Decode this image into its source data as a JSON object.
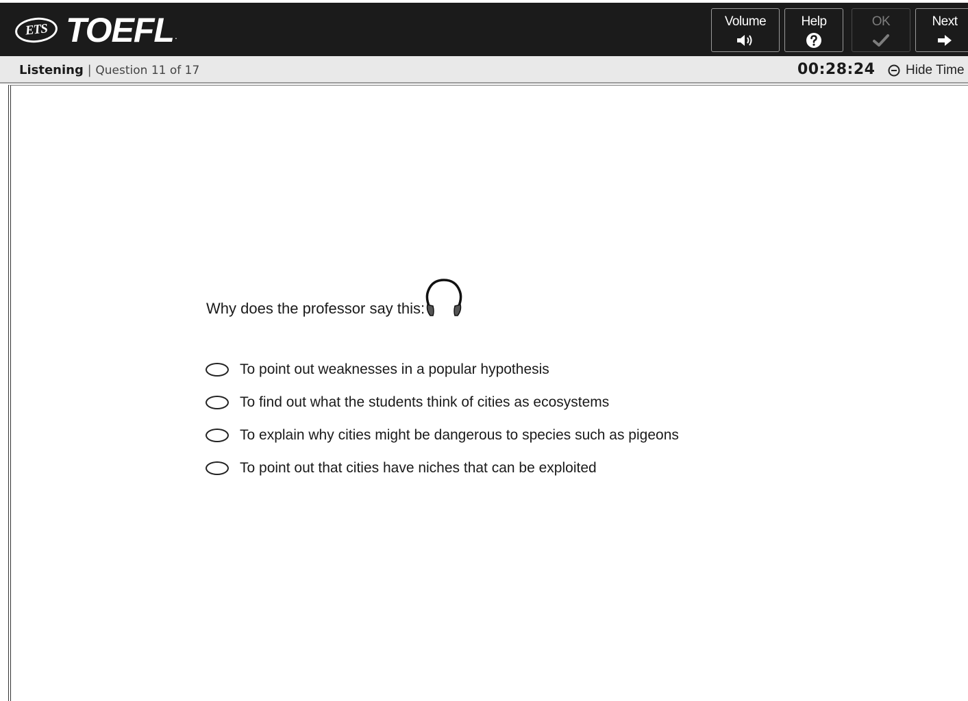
{
  "header": {
    "logo": {
      "ets": "ETS",
      "product": "TOEFL",
      "dot": "."
    },
    "buttons": {
      "volume": {
        "label": "Volume",
        "icon": "speaker-icon"
      },
      "help": {
        "label": "Help",
        "icon": "question-circle-icon"
      },
      "ok": {
        "label": "OK",
        "icon": "checkmark-icon",
        "disabled": true
      },
      "next": {
        "label": "Next",
        "icon": "arrow-right-icon"
      }
    }
  },
  "status": {
    "section": "Listening",
    "separator": "|",
    "question_progress": "Question 11 of 17",
    "timer": "00:28:24",
    "hide_time_label": "Hide Time"
  },
  "question": {
    "prompt": "Why does the professor say this:",
    "audio_icon": "headphones-icon",
    "options": [
      "To point out weaknesses in a popular hypothesis",
      "To find out what the students think of cities as ecosystems",
      "To explain why cities might be dangerous to species such as pigeons",
      "To point out that cities have niches that can be exploited"
    ]
  },
  "colors": {
    "topbar": "#1b1b1b",
    "statusbar": "#e9e9e9",
    "disabled_button_text": "#7d7d7d"
  }
}
